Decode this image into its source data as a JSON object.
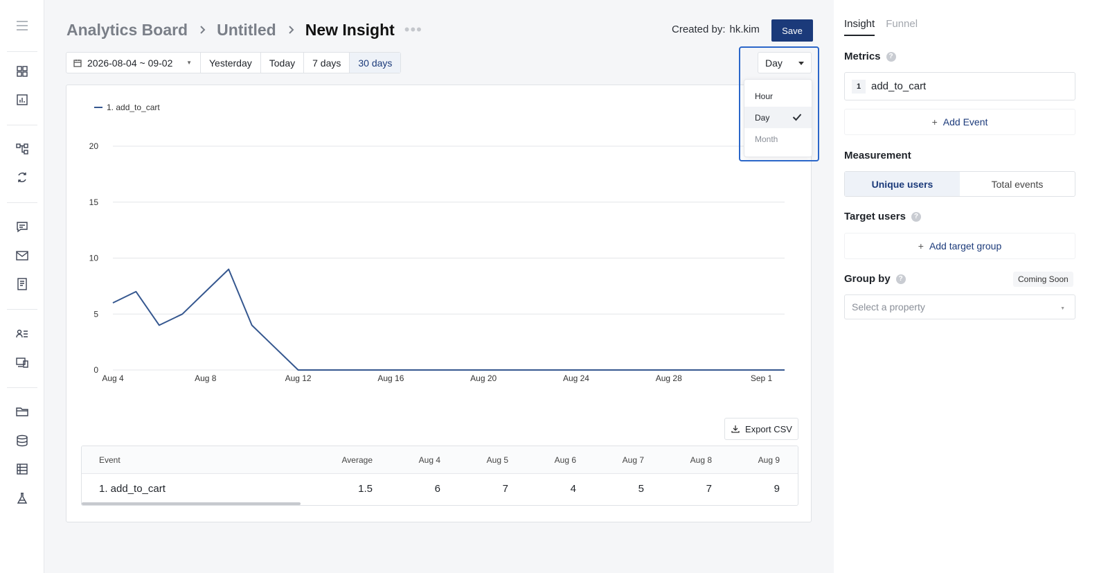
{
  "app": {
    "title": "Analytics Board"
  },
  "rail": {
    "icons": [
      "menu-icon",
      "dashboard-icon",
      "report-icon",
      "flow-icon",
      "refresh-icon",
      "message-icon",
      "mail-icon",
      "document-icon",
      "users-list-icon",
      "devices-icon",
      "folder-icon",
      "database-icon",
      "table-icon",
      "flask-icon"
    ]
  },
  "header": {
    "crumbs": [
      "Analytics Board",
      "Untitled",
      "New Insight"
    ],
    "more": "•••",
    "created_label": "Created by:",
    "created_value": "hk.kim",
    "save_label": "Save"
  },
  "datebar": {
    "range": "2026-08-04 ~ 09-02",
    "presets": [
      "Yesterday",
      "Today",
      "7 days",
      "30 days"
    ],
    "active_preset": "30 days"
  },
  "granularity": {
    "selected": "Day",
    "options": [
      {
        "label": "Hour",
        "selected": false
      },
      {
        "label": "Day",
        "selected": true
      },
      {
        "label": "Month",
        "selected": false
      }
    ]
  },
  "chart_data": {
    "type": "line",
    "title": "",
    "xlabel": "",
    "ylabel": "",
    "legend": "top-left",
    "grid": true,
    "ylim": [
      0,
      20
    ],
    "yticks": [
      0,
      5,
      10,
      15,
      20
    ],
    "xticks": [
      "Aug 4",
      "Aug 8",
      "Aug 12",
      "Aug 16",
      "Aug 20",
      "Aug 24",
      "Aug 28",
      "Sep 1"
    ],
    "x": [
      "Aug 4",
      "Aug 5",
      "Aug 6",
      "Aug 7",
      "Aug 8",
      "Aug 9",
      "Aug 10",
      "Aug 11",
      "Aug 12",
      "Aug 13",
      "Aug 14",
      "Aug 15",
      "Aug 16",
      "Aug 17",
      "Aug 18",
      "Aug 19",
      "Aug 20",
      "Aug 21",
      "Aug 22",
      "Aug 23",
      "Aug 24",
      "Aug 25",
      "Aug 26",
      "Aug 27",
      "Aug 28",
      "Aug 29",
      "Aug 30",
      "Aug 31",
      "Sep 1",
      "Sep 2"
    ],
    "series": [
      {
        "name": "1. add_to_cart",
        "color": "#35578f",
        "values": [
          6,
          7,
          4,
          5,
          7,
          9,
          4,
          2,
          0,
          0,
          0,
          0,
          0,
          0,
          0,
          0,
          0,
          0,
          0,
          0,
          0,
          0,
          0,
          0,
          0,
          0,
          0,
          0,
          0,
          0
        ]
      }
    ]
  },
  "export_label": "Export CSV",
  "table": {
    "headers": [
      "Event",
      "Average",
      "Aug 4",
      "Aug 5",
      "Aug 6",
      "Aug 7",
      "Aug 8",
      "Aug 9"
    ],
    "rows": [
      [
        "1. add_to_cart",
        "1.5",
        "6",
        "7",
        "4",
        "5",
        "7",
        "9"
      ]
    ]
  },
  "side": {
    "tabs": [
      "Insight",
      "Funnel"
    ],
    "metrics_label": "Metrics",
    "metric_num": "1",
    "metric_event": "add_to_cart",
    "add_event": "Add Event",
    "measurement_label": "Measurement",
    "measurement_options": [
      "Unique users",
      "Total events"
    ],
    "target_label": "Target users",
    "add_target": "Add target group",
    "group_label": "Group by",
    "coming_soon": "Coming Soon",
    "property_placeholder": "Select a property",
    "help_glyph": "?",
    "plus_glyph": "+"
  }
}
